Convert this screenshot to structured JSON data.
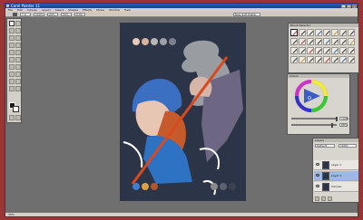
{
  "app": {
    "title": "Corel Painter 11"
  },
  "menu": [
    "File",
    "Edit",
    "Canvas",
    "Layers",
    "Select",
    "Shapes",
    "Effects",
    "Movie",
    "Window",
    "Help"
  ],
  "propbar": {
    "size": "7.0",
    "opacity": "100%",
    "resat": "20%",
    "bleed": "50%",
    "jitter": "0.00",
    "variant": "Real Soft Pastel"
  },
  "palette_colors": [
    "#e8c9b8",
    "#d9b19c",
    "#b6b6b6",
    "#9fa1aa",
    "#7c808c"
  ],
  "swatch_colors": [
    "#3f7fd0",
    "#d9a04a",
    "#b3562c",
    "#8a8a8a",
    "#5d6170",
    "#3f4350"
  ],
  "brushes": {
    "title": "Brush Selector"
  },
  "colors": {
    "title": "Colors",
    "saturation": "100%",
    "value": "88%",
    "hue_accent": "#3d5ccc"
  },
  "layers": {
    "title": "Layers",
    "mode": "Default",
    "opacity": "100%",
    "items": [
      {
        "name": "Layer 1",
        "selected": false
      },
      {
        "name": "Layer 2",
        "selected": true
      },
      {
        "name": "Canvas",
        "selected": false
      }
    ]
  },
  "status": {
    "zoom": "33%"
  }
}
